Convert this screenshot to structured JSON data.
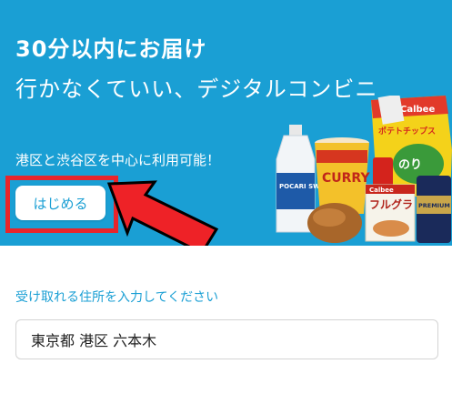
{
  "hero": {
    "title_line1": "30分以内にお届け",
    "title_line2": "行かなくていい、デジタルコンビニ",
    "subtitle": "港区と渋谷区を中心に利用可能！",
    "start_button": "はじめる",
    "background_color": "#1a9fd4",
    "highlight_color": "#e8252b",
    "product_labels": {
      "water": "POCARI SWEAT",
      "noodle": "CURRY",
      "chips_brand": "Calbee",
      "chips_name": "ポテトチップス",
      "cereal_brand": "Calbee",
      "cereal_name": "フルグラ",
      "beer": "PREMIUM"
    }
  },
  "address": {
    "label": "受け取れる住所を入力してください",
    "value": "東京都 港区 六本木"
  }
}
